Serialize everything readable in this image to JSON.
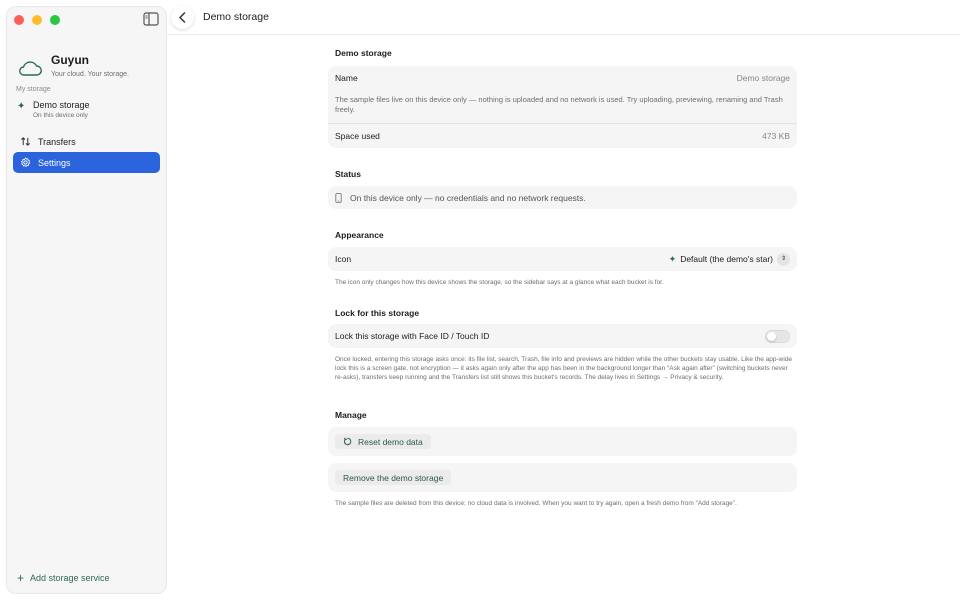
{
  "app": {
    "name": "Guyun",
    "tagline": "Your cloud. Your storage."
  },
  "sidebar": {
    "section_label": "My storage",
    "storage": {
      "name": "Demo storage",
      "subtitle": "On this device only"
    },
    "nav": {
      "transfers": "Transfers",
      "settings": "Settings"
    },
    "add_service": "Add storage service"
  },
  "header": {
    "title": "Demo storage"
  },
  "settings": {
    "demo_storage": {
      "title": "Demo storage",
      "name_label": "Name",
      "name_value": "Demo storage",
      "description": "The sample files live on this device only — nothing is uploaded and no network is used. Try uploading, previewing, renaming and Trash freely.",
      "space_label": "Space used",
      "space_value": "473 KB"
    },
    "status": {
      "title": "Status",
      "text": "On this device only — no credentials and no network requests."
    },
    "appearance": {
      "title": "Appearance",
      "icon_label": "Icon",
      "icon_value": "Default (the demo's star)",
      "note": "The icon only changes how this device shows the storage, so the sidebar says at a glance what each bucket is for."
    },
    "lock": {
      "title": "Lock for this storage",
      "toggle_label": "Lock this storage with Face ID / Touch ID",
      "toggle_on": false,
      "note": "Once locked, entering this storage asks once: its file list, search, Trash, file info and previews are hidden while the other buckets stay usable. Like the app-wide lock this is a screen gate, not encryption — it asks again only after the app has been in the background longer than “Ask again after” (switching buckets never re-asks), transfers keep running and the Transfers list still shows this bucket's records. The delay lives in Settings → Privacy & security."
    },
    "manage": {
      "title": "Manage",
      "reset_label": "Reset demo data",
      "remove_label": "Remove the demo storage",
      "note": "The sample files are deleted from this device; no cloud data is involved. When you want to try again, open a fresh demo from “Add storage”."
    }
  },
  "colors": {
    "accent": "#2a63db",
    "brand_green": "#2d6a4f",
    "card_bg": "#f5f5f5"
  },
  "icons": {
    "brand": "cloud-icon",
    "storage": "sparkle-icon",
    "transfers": "arrows-up-down-icon",
    "settings": "gear-icon",
    "status": "phone-icon",
    "reset": "reset-arrow-icon",
    "back": "chevron-left-icon",
    "sidebar_toggle": "sidebar-toggle-icon",
    "add": "plus-icon"
  }
}
